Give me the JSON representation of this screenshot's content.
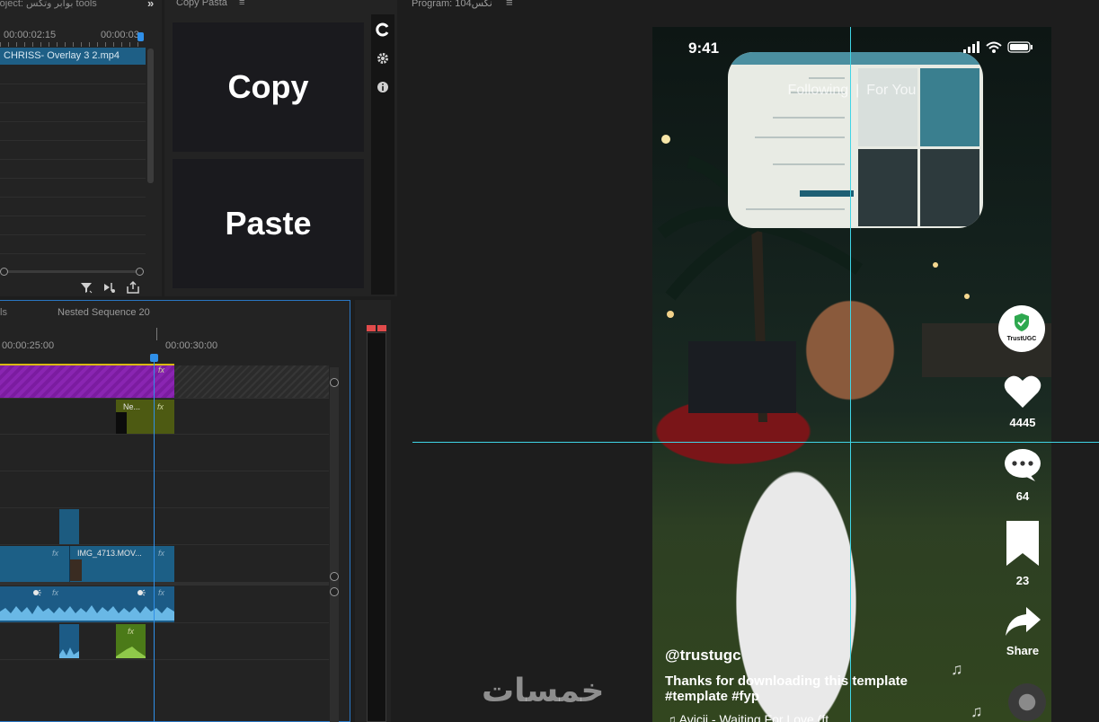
{
  "project_panel": {
    "tab_label": "roject: بوابر وتكس tools",
    "overflow_glyph": "»",
    "timecode_start": "00:00:02:15",
    "timecode_end": "00:00:03",
    "clip_name": "CHRISS- Overlay 3 2.mp4",
    "tools": [
      "filter-icon",
      "automate-to-sequence-icon",
      "export-icon"
    ]
  },
  "copy_pasta": {
    "title": "Copy Pasta",
    "menu_glyph": "≡",
    "copy_label": "Copy",
    "paste_label": "Paste",
    "side_icons": [
      "refresh-logo-icon",
      "gear-icon",
      "info-icon"
    ]
  },
  "timeline": {
    "tab_left": "ls",
    "tab_nested": "Nested Sequence 20",
    "timecode_1": "00:00:25:00",
    "timecode_2": "00:00:30:00",
    "nested_clip_label": "Ne...",
    "img_clip_label": "IMG_4713.MOV...",
    "fx_label": "fx"
  },
  "program_monitor": {
    "title": "Program: نكس104",
    "menu_glyph": "≡"
  },
  "video": {
    "status_time": "9:41",
    "tab_following": "Following",
    "tab_separator": "|",
    "tab_for_you": "For You",
    "badge_label": "TrustUGC",
    "likes": "4445",
    "comments": "64",
    "saves": "23",
    "share_label": "Share",
    "username": "@trustugc",
    "caption": "Thanks for downloading this template #template #fyp",
    "music": "Avicii - Waiting For Love (ft"
  },
  "watermark": "خمسات",
  "colors": {
    "accent_blue": "#2f8fe8",
    "guide_cyan": "#3fd5e6",
    "track_purple": "#7b1ca0",
    "clip_blue": "#1c5f86",
    "clip_green": "#4d5a12",
    "badge_green": "#2ea84f"
  }
}
